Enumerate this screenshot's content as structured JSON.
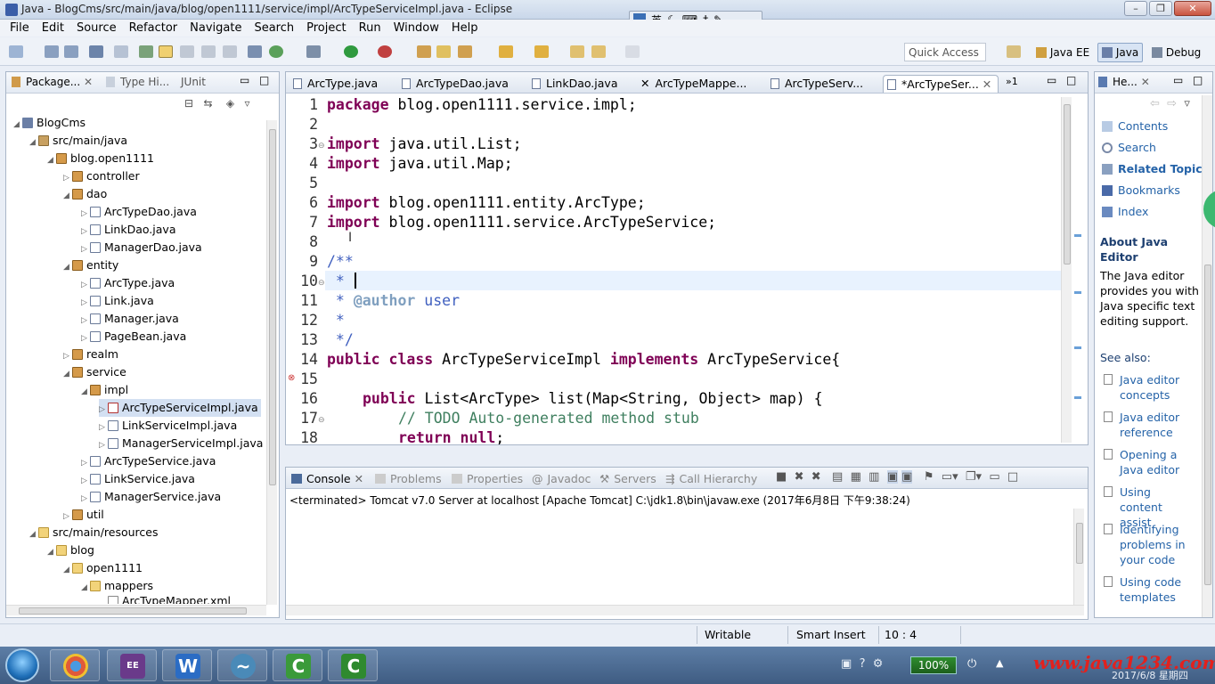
{
  "window": {
    "title": "Java - BlogCms/src/main/java/blog/open1111/service/impl/ArcTypeServiceImpl.java - Eclipse"
  },
  "ime": {
    "lang": "英"
  },
  "menus": [
    "File",
    "Edit",
    "Source",
    "Refactor",
    "Navigate",
    "Search",
    "Project",
    "Run",
    "Window",
    "Help"
  ],
  "toolbar": {
    "quick_access_placeholder": "Quick Access",
    "perspectives": [
      "Java EE",
      "Java",
      "Debug"
    ]
  },
  "package_explorer": {
    "tabs": [
      "Package...",
      "Type Hi...",
      "JUnit"
    ],
    "rows": [
      {
        "label": "BlogCms",
        "icon": "project-icon"
      },
      {
        "label": "src/main/java",
        "icon": "source-folder-icon"
      },
      {
        "label": "blog.open1111",
        "icon": "package-icon"
      },
      {
        "label": "controller",
        "icon": "package-icon"
      },
      {
        "label": "dao",
        "icon": "package-icon"
      },
      {
        "label": "ArcTypeDao.java",
        "icon": "java-file-icon"
      },
      {
        "label": "LinkDao.java",
        "icon": "java-file-icon"
      },
      {
        "label": "ManagerDao.java",
        "icon": "java-file-icon"
      },
      {
        "label": "entity",
        "icon": "package-icon"
      },
      {
        "label": "ArcType.java",
        "icon": "java-file-icon"
      },
      {
        "label": "Link.java",
        "icon": "java-file-icon"
      },
      {
        "label": "Manager.java",
        "icon": "java-file-icon"
      },
      {
        "label": "PageBean.java",
        "icon": "java-file-icon"
      },
      {
        "label": "realm",
        "icon": "package-icon"
      },
      {
        "label": "service",
        "icon": "package-icon"
      },
      {
        "label": "impl",
        "icon": "package-icon"
      },
      {
        "label": "ArcTypeServiceImpl.java",
        "icon": "java-file-icon"
      },
      {
        "label": "LinkServiceImpl.java",
        "icon": "java-file-icon"
      },
      {
        "label": "ManagerServiceImpl.java",
        "icon": "java-file-icon"
      },
      {
        "label": "ArcTypeService.java",
        "icon": "java-file-icon"
      },
      {
        "label": "LinkService.java",
        "icon": "java-file-icon"
      },
      {
        "label": "ManagerService.java",
        "icon": "java-file-icon"
      },
      {
        "label": "util",
        "icon": "package-icon"
      },
      {
        "label": "src/main/resources",
        "icon": "folder-icon"
      },
      {
        "label": "blog",
        "icon": "folder-icon"
      },
      {
        "label": "open1111",
        "icon": "folder-icon"
      },
      {
        "label": "mappers",
        "icon": "folder-icon"
      },
      {
        "label": "ArcTypeMapper.xml",
        "icon": "xml-file-icon"
      }
    ]
  },
  "editor": {
    "tabs": [
      "ArcType.java",
      "ArcTypeDao.java",
      "LinkDao.java",
      "ArcTypeMappe...",
      "ArcTypeServ...",
      "*ArcTypeSer..."
    ],
    "overflow_tabs": "1",
    "line_numbers": [
      "1",
      "2",
      "3",
      "4",
      "5",
      "6",
      "7",
      "8",
      "9",
      "10",
      "11",
      "12",
      "13",
      "14",
      "15",
      "16",
      "17",
      "18"
    ],
    "code": {
      "l1_kw": "package",
      "l1_rest": " blog.open1111.service.impl;",
      "l3_kw": "import",
      "l3_rest": " java.util.List;",
      "l4_kw": "import",
      "l4_rest": " java.util.Map;",
      "l6_kw": "import",
      "l6_rest": " blog.open1111.entity.ArcType;",
      "l7_kw": "import",
      "l7_rest": " blog.open1111.service.ArcTypeService;",
      "l9": "/**",
      "l10": " * ",
      "l11_star": " * ",
      "l11_tag": "@author",
      "l11_rest": " user",
      "l12": " *",
      "l13": " */",
      "l14_kw1": "public",
      "l14_kw2": "class",
      "l14_name": " ArcTypeServiceImpl ",
      "l14_kw3": "implements",
      "l14_rest": " ArcTypeService{",
      "l16_kw": "public",
      "l16_rest": " List<ArcType> list(Map<String, Object> map) {",
      "l17": "// TODO Auto-generated method stub",
      "l18_kw": "return",
      "l18_null": "null",
      "l18_semi": ";"
    }
  },
  "console": {
    "tabs": [
      "Console",
      "Problems",
      "Properties",
      "Javadoc",
      "Servers",
      "Call Hierarchy"
    ],
    "status_line": "<terminated> Tomcat v7.0 Server at localhost [Apache Tomcat] C:\\jdk1.8\\bin\\javaw.exe (2017年6月8日 下午9:38:24)"
  },
  "help": {
    "tab": "He...",
    "links": [
      "Contents",
      "Search",
      "Related Topics",
      "Bookmarks",
      "Index"
    ],
    "about_title": "About Java Editor",
    "about_body": "The Java editor provides you with Java specific text editing support.",
    "see_also": "See also:",
    "see_also_links": [
      "Java editor concepts",
      "Java editor reference",
      "Opening a Java editor",
      "Using content assist",
      "Identifying problems in your code",
      "Using code templates"
    ]
  },
  "statusbar": {
    "writable": "Writable",
    "insert_mode": "Smart Insert",
    "position": "10 : 4"
  },
  "taskbar": {
    "battery": "100%",
    "watermark": "www.java1234.com",
    "date": "2017/6/8 星期四"
  }
}
